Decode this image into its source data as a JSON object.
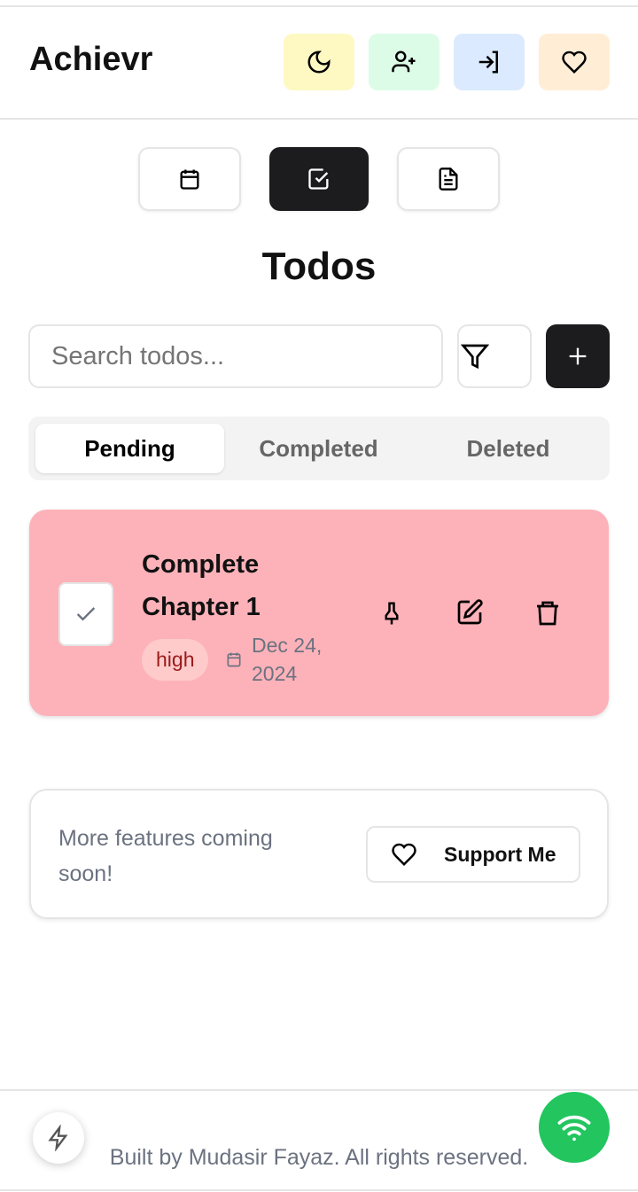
{
  "header": {
    "title": "Achievr",
    "buttons": [
      {
        "icon": "moon-icon",
        "color": "#fef9c3"
      },
      {
        "icon": "user-plus-icon",
        "color": "#dcfce7"
      },
      {
        "icon": "login-icon",
        "color": "#dbeafe"
      },
      {
        "icon": "heart-icon",
        "color": "#ffedd5"
      }
    ]
  },
  "nav": [
    {
      "icon": "calendar-icon",
      "active": false
    },
    {
      "icon": "checkbox-icon",
      "active": true
    },
    {
      "icon": "document-icon",
      "active": false
    }
  ],
  "page_title": "Todos",
  "search": {
    "placeholder": "Search todos...",
    "value": ""
  },
  "tabs": [
    {
      "label": "Pending",
      "active": true
    },
    {
      "label": "Completed",
      "active": false
    },
    {
      "label": "Deleted",
      "active": false
    }
  ],
  "todos": [
    {
      "title_line1": "Complete",
      "title_line2": "Chapter 1",
      "priority": "high",
      "date_line1": "Dec 24,",
      "date_line2": "2024",
      "color": "#fdb2b9"
    }
  ],
  "promo": {
    "text_line1": "More features coming",
    "text_line2": "soon!",
    "button": "Support Me"
  },
  "footer": {
    "text": "Built by Mudasir Fayaz. All rights reserved."
  },
  "colors": {
    "dark": "#1c1c1e",
    "online": "#22c55e"
  }
}
